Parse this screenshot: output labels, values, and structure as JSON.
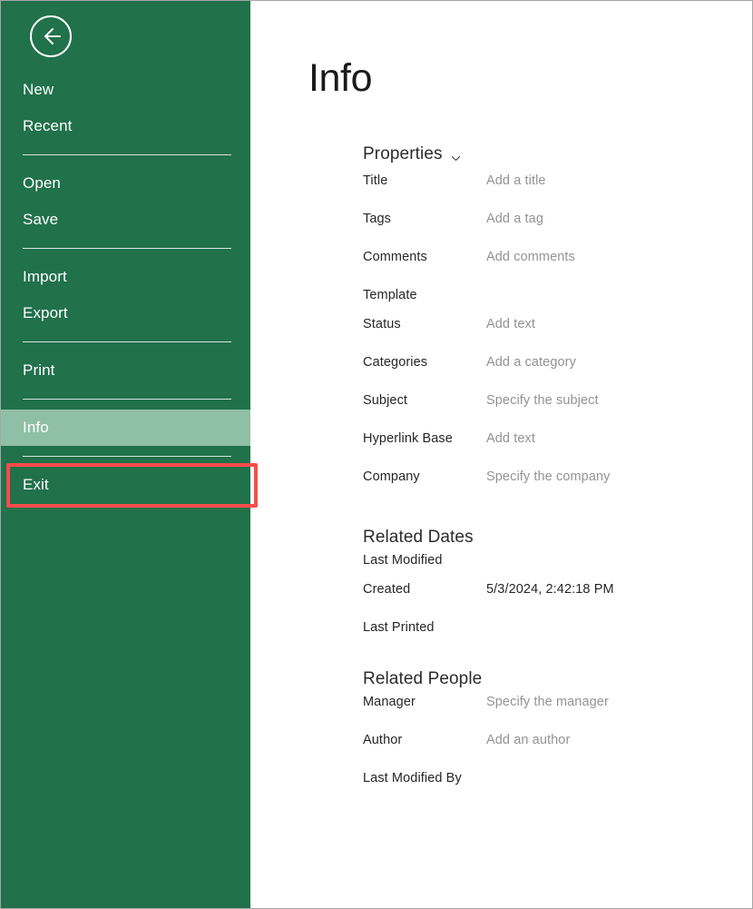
{
  "sidebar": {
    "back_icon": "back-arrow-icon",
    "items": [
      {
        "label": "New",
        "selected": false
      },
      {
        "label": "Recent",
        "selected": false
      },
      {
        "separator_after": true
      },
      {
        "label": "Open",
        "selected": false
      },
      {
        "label": "Save",
        "selected": false
      },
      {
        "separator_after": true
      },
      {
        "label": "Import",
        "selected": false
      },
      {
        "label": "Export",
        "selected": false
      },
      {
        "separator_after": true
      },
      {
        "label": "Print",
        "selected": false
      },
      {
        "separator_after": true
      },
      {
        "label": "Info",
        "selected": true
      },
      {
        "separator_after": true
      },
      {
        "label": "Exit",
        "selected": false
      }
    ],
    "colors": {
      "background": "#21714a",
      "selected_background": "#8fbfa4",
      "text": "#ffffff"
    }
  },
  "annotation": {
    "target": "Info",
    "color": "#fa4b4b"
  },
  "main": {
    "title": "Info",
    "sections": [
      {
        "heading": "Properties",
        "has_chevron": true,
        "chevron_icon": "chevron-down-icon",
        "rows": [
          {
            "label": "Title",
            "value": "Add a title",
            "placeholder": true
          },
          {
            "label": "Tags",
            "value": "Add a tag",
            "placeholder": true
          },
          {
            "label": "Comments",
            "value": "Add comments",
            "placeholder": true
          },
          {
            "label": "Template",
            "value": "",
            "placeholder": false
          },
          {
            "label": "Status",
            "value": "Add text",
            "placeholder": true
          },
          {
            "label": "Categories",
            "value": "Add a category",
            "placeholder": true
          },
          {
            "label": "Subject",
            "value": "Specify the subject",
            "placeholder": true
          },
          {
            "label": "Hyperlink Base",
            "value": "Add text",
            "placeholder": true
          },
          {
            "label": "Company",
            "value": "Specify the company",
            "placeholder": true
          }
        ]
      },
      {
        "heading": "Related Dates",
        "has_chevron": false,
        "rows": [
          {
            "label": "Last Modified",
            "value": "",
            "placeholder": false
          },
          {
            "label": "Created",
            "value": "5/3/2024, 2:42:18 PM",
            "placeholder": false
          },
          {
            "label": "Last Printed",
            "value": "",
            "placeholder": false
          }
        ]
      },
      {
        "heading": "Related People",
        "has_chevron": false,
        "rows": [
          {
            "label": "Manager",
            "value": "Specify the manager",
            "placeholder": true
          },
          {
            "label": "Author",
            "value": "Add an author",
            "placeholder": true
          },
          {
            "label": "Last Modified By",
            "value": "",
            "placeholder": false
          }
        ]
      }
    ]
  }
}
